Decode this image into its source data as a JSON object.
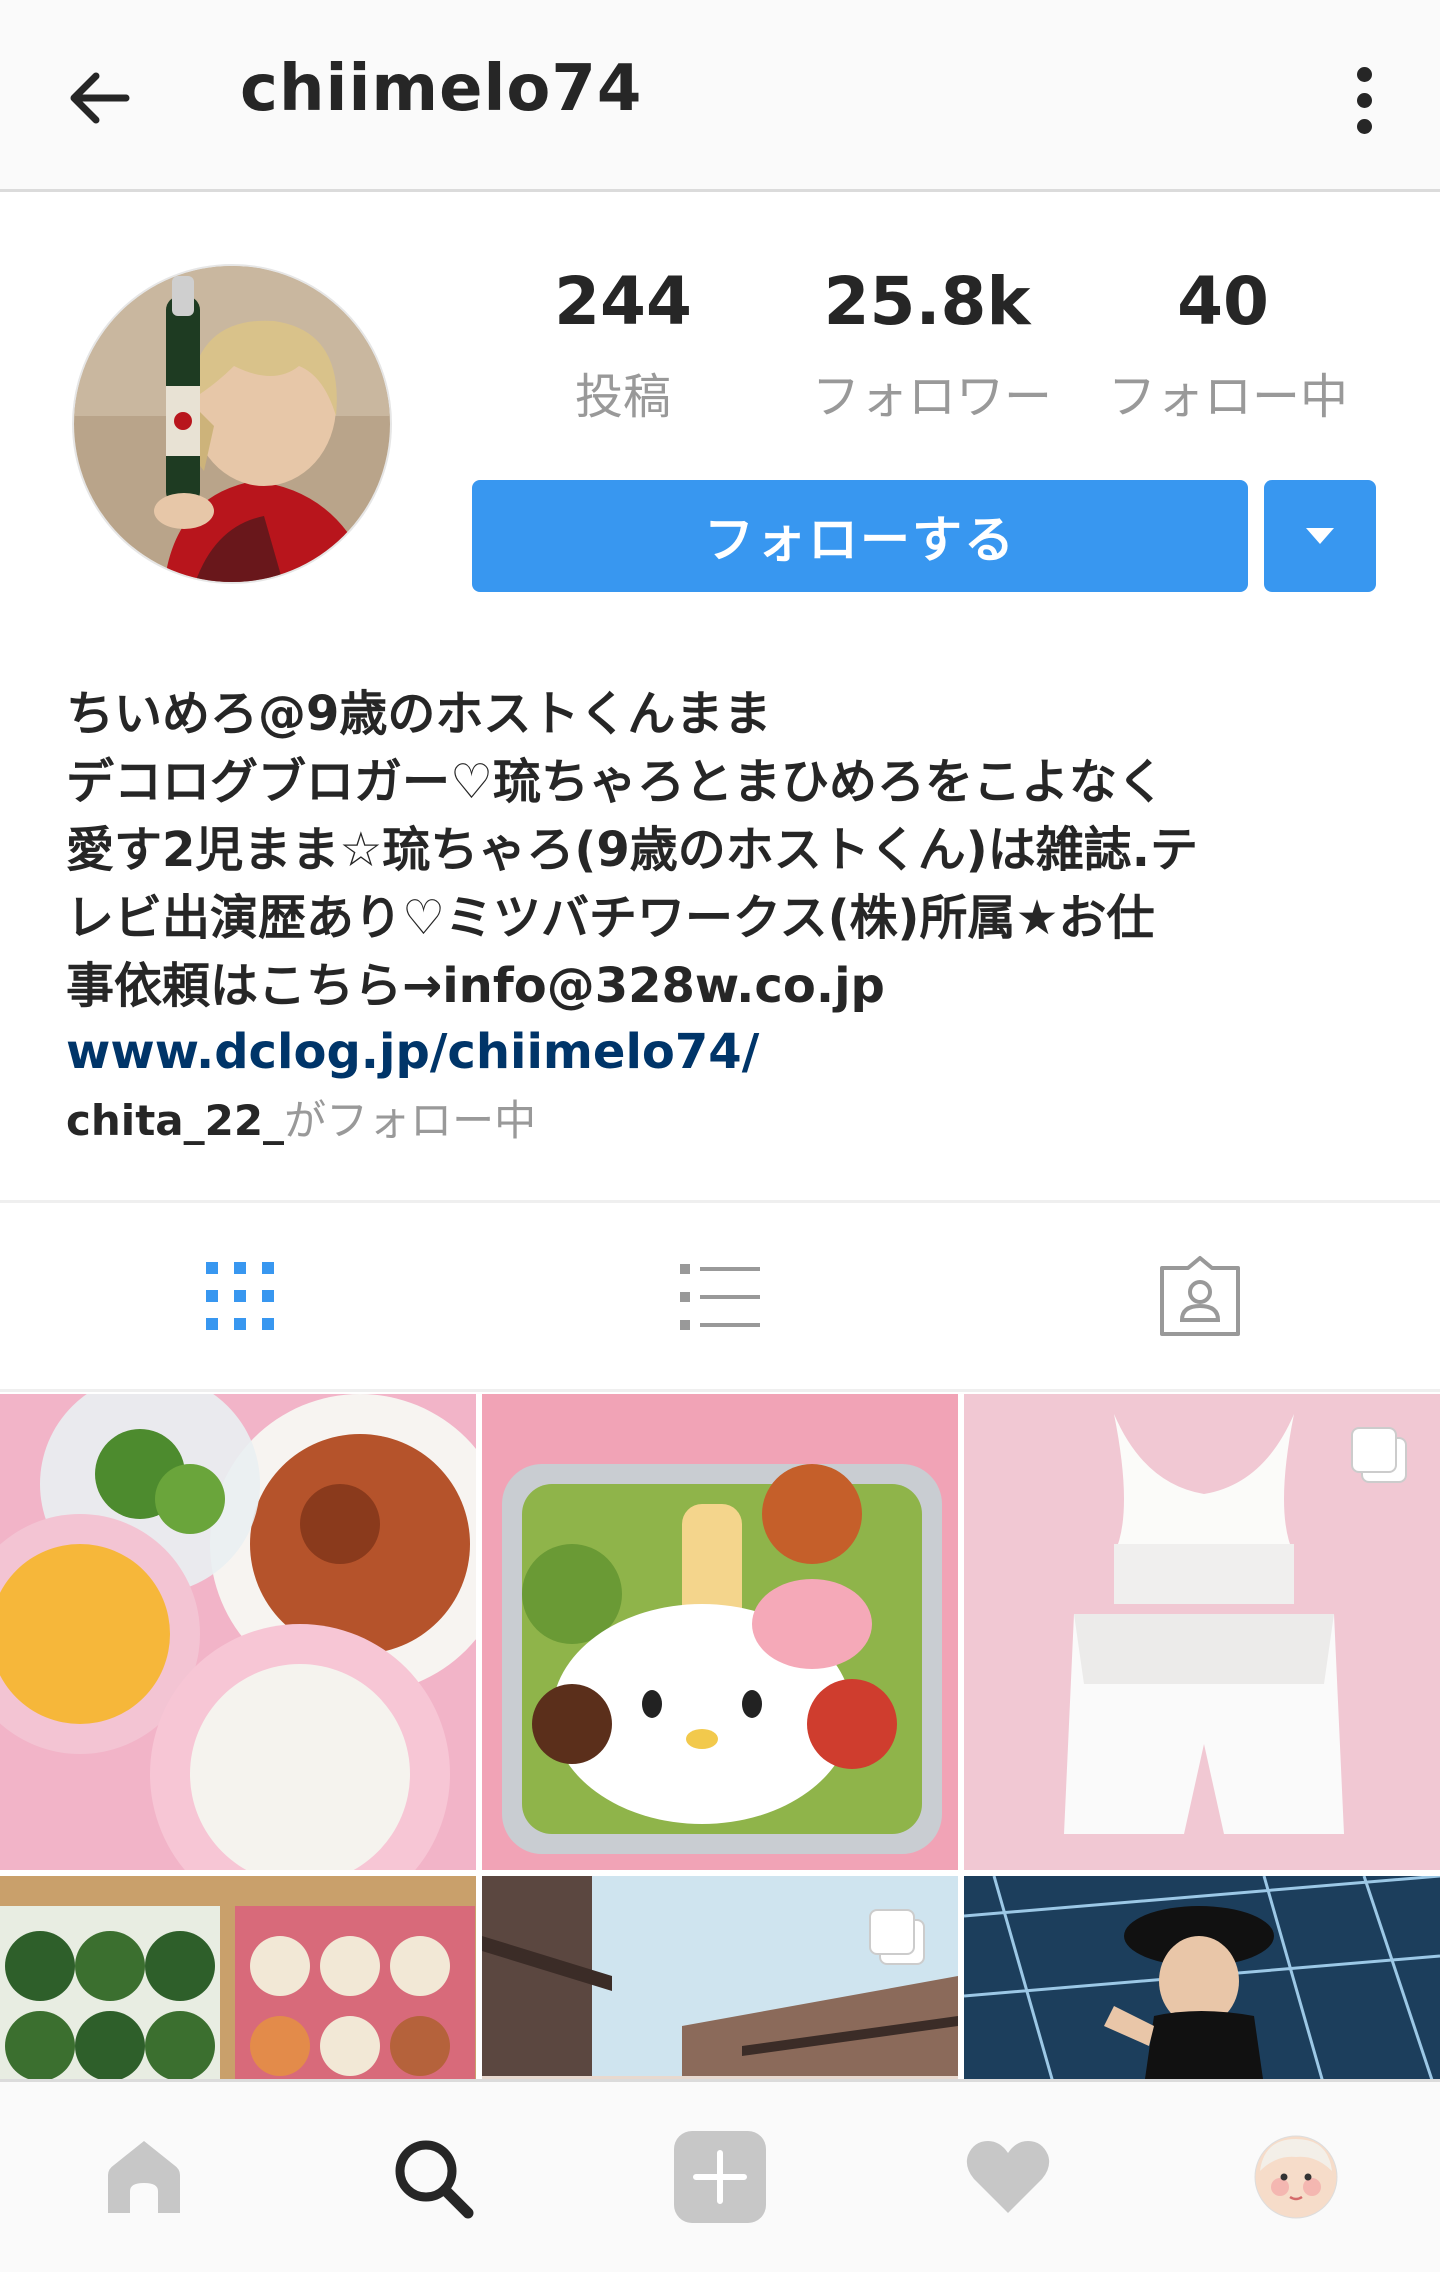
{
  "header": {
    "username": "chiimelo74",
    "back_icon": "arrow-left-icon",
    "more_icon": "more-vertical-icon"
  },
  "stats": {
    "posts_count": "244",
    "posts_label": "投稿",
    "followers_count": "25.8k",
    "followers_label": "フォロワー",
    "following_count": "40",
    "following_label": "フォロー中"
  },
  "actions": {
    "follow_label": "フォローする",
    "dropdown_icon": "caret-down-icon"
  },
  "bio": {
    "name": "ちいめろ@9歳のホストくんまま",
    "text": "デコログブロガー♡琉ちゃろとまひめろをこよなく\n愛す2児まま☆琉ちゃろ(9歳のホストくん)は雑誌.テ\nレビ出演歴あり♡ミツバチワークス(株)所属★お仕\n事依頼はこちら→info@328w.co.jp",
    "link": "www.dclog.jp/chiimelo74/",
    "followed_by_user": "chita_22_",
    "followed_by_suffix": "がフォロー中"
  },
  "tabs": [
    {
      "icon": "grid-icon",
      "active": true
    },
    {
      "icon": "list-icon",
      "active": false
    },
    {
      "icon": "tagged-photos-icon",
      "active": false
    }
  ],
  "bottom_nav": [
    {
      "icon": "home-icon"
    },
    {
      "icon": "search-icon",
      "active": true
    },
    {
      "icon": "add-post-icon"
    },
    {
      "icon": "heart-icon"
    },
    {
      "icon": "profile-avatar-icon"
    }
  ],
  "colors": {
    "accent": "#3897f0",
    "link": "#003569",
    "muted": "#999999",
    "text": "#262626"
  }
}
